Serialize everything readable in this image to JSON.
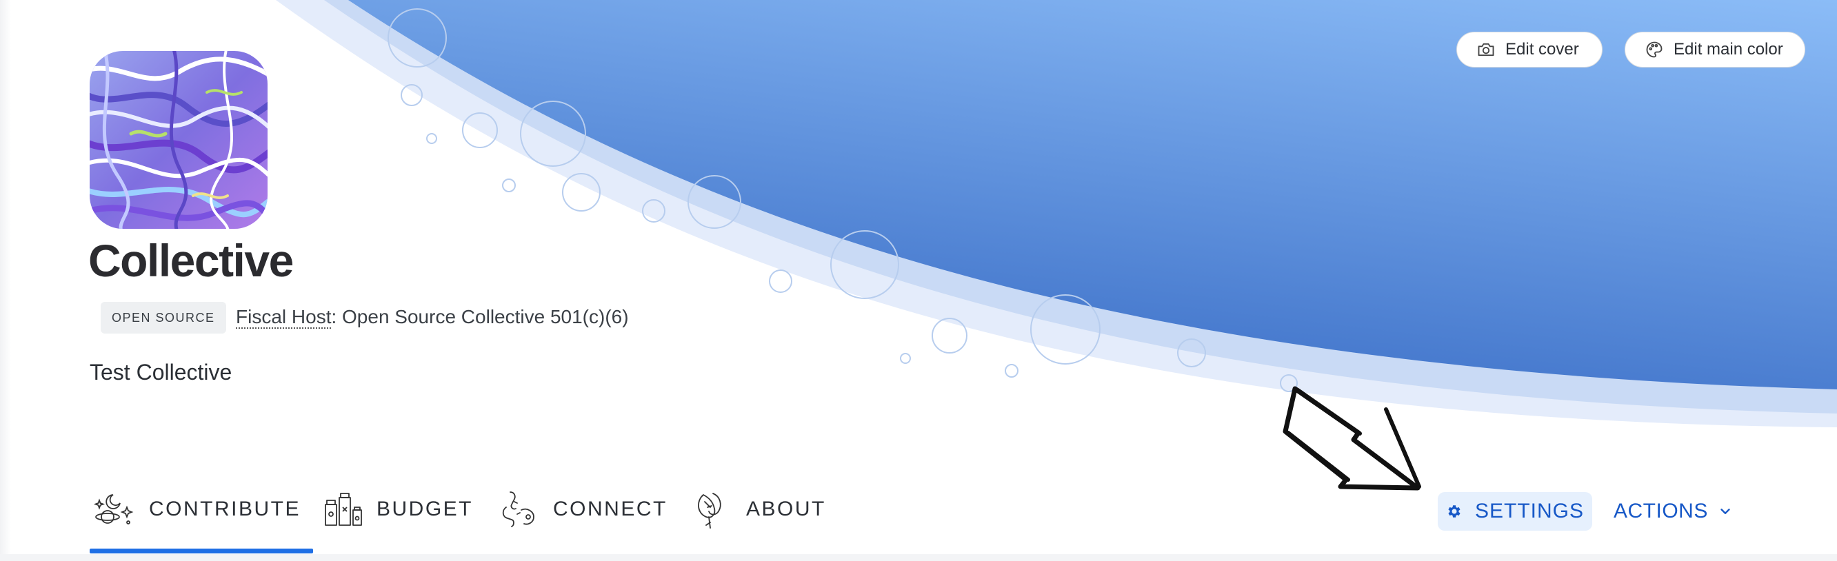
{
  "cover": {
    "edit_cover_label": "Edit cover",
    "edit_color_label": "Edit main color",
    "accent_top": "#8bbcf7",
    "accent_bottom": "#3f72c9"
  },
  "collective": {
    "name": "Collective",
    "tag": "OPEN SOURCE",
    "fiscal_host_label": "Fiscal Host",
    "fiscal_host_value": ": Open Source Collective 501(c)(6)",
    "description": "Test Collective"
  },
  "nav": {
    "items": [
      {
        "label": "CONTRIBUTE",
        "icon": "contribute-icon",
        "active": true
      },
      {
        "label": "BUDGET",
        "icon": "budget-icon",
        "active": false
      },
      {
        "label": "CONNECT",
        "icon": "connect-icon",
        "active": false
      },
      {
        "label": "ABOUT",
        "icon": "about-icon",
        "active": false
      }
    ],
    "settings_label": "SETTINGS",
    "actions_label": "ACTIONS",
    "active_color": "#1f6fe5",
    "link_color": "#1758c7"
  }
}
